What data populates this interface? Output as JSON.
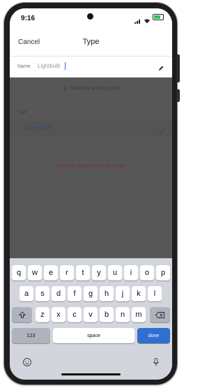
{
  "status": {
    "time": "9:16"
  },
  "nav": {
    "cancel": "Cancel",
    "title": "Type"
  },
  "name_field": {
    "label": "Name",
    "value": "Lightbulb"
  },
  "content": {
    "blink_label": "Make the product blink",
    "type_label": "Type",
    "type_value": "Micromodule",
    "remove_label": "Remove product from the room"
  },
  "keyboard": {
    "row1": [
      "q",
      "w",
      "e",
      "r",
      "t",
      "y",
      "u",
      "i",
      "o",
      "p"
    ],
    "row2": [
      "a",
      "s",
      "d",
      "f",
      "g",
      "h",
      "j",
      "k",
      "l"
    ],
    "row3": [
      "z",
      "x",
      "c",
      "v",
      "b",
      "n",
      "m"
    ],
    "numbers": "123",
    "space": "space",
    "done": "done"
  },
  "colors": {
    "done_key": "#2f6fd1",
    "check": "#2e4a7a",
    "remove_text": "#7a3030"
  }
}
